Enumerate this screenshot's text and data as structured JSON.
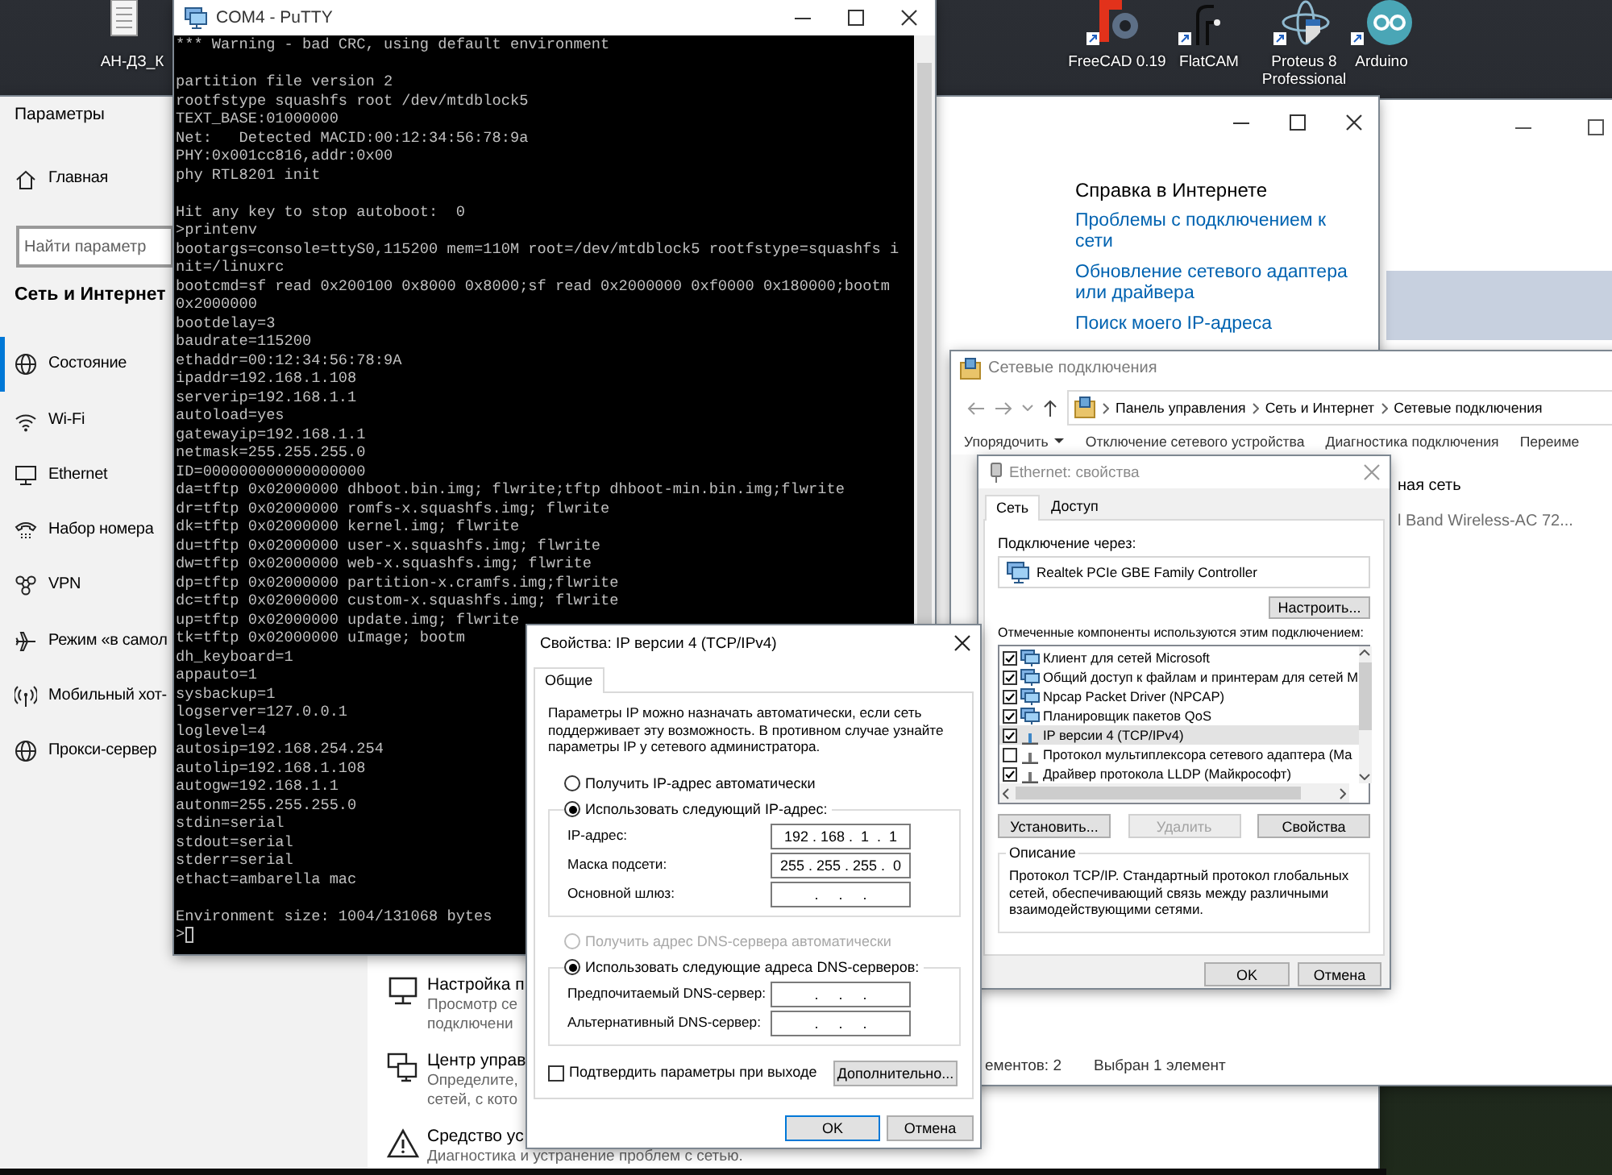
{
  "desktop": {
    "icons": [
      {
        "label": "АН-ДЗ_К"
      },
      {
        "label": "FreeCAD 0.19"
      },
      {
        "label": "FlatCAM"
      },
      {
        "label": "Proteus 8 Professional"
      },
      {
        "label": "Arduino"
      }
    ]
  },
  "settings": {
    "title": "Параметры",
    "home": "Главная",
    "search": {
      "placeholder": "Найти параметр"
    },
    "section": "Сеть и Интернет",
    "nav": [
      {
        "label": "Состояние",
        "selected": true
      },
      {
        "label": "Wi-Fi",
        "selected": false
      },
      {
        "label": "Ethernet",
        "selected": false
      },
      {
        "label": "Набор номера",
        "selected": false
      },
      {
        "label": "VPN",
        "selected": false
      },
      {
        "label": "Режим «в самол",
        "selected": false
      },
      {
        "label": "Мобильный хот-",
        "selected": false
      },
      {
        "label": "Прокси-сервер",
        "selected": false
      }
    ],
    "help": {
      "title": "Справка в Интернете",
      "links": [
        "Проблемы с подключением к сети",
        "Обновление сетевого адаптера или драйвера",
        "Поиск моего IP-адреса"
      ]
    },
    "related": [
      {
        "title": "Настройка п",
        "lines": [
          "Просмотр се",
          "подключени"
        ]
      },
      {
        "title": "Центр управ",
        "lines": [
          "Определите,",
          "сетей, с кото"
        ]
      },
      {
        "title": "Средство ус",
        "lines": [
          "Диагностика и устранение проблем с сетью."
        ]
      }
    ]
  },
  "putty": {
    "title": "COM4 - PuTTY",
    "blocks": [
      [
        "*** Warning - bad CRC, using default environment"
      ],
      [
        "partition file version 2",
        "rootfstype squashfs root /dev/mtdblock5",
        "TEXT_BASE:01000000",
        "Net:   Detected MACID:00:12:34:56:78:9a",
        "PHY:0x001cc816,addr:0x00",
        "phy RTL8201 init"
      ],
      [
        "Hit any key to stop autoboot:  0",
        ">printenv",
        "bootargs=console=ttyS0,115200 mem=110M root=/dev/mtdblock5 rootfstype=squashfs i",
        "nit=/linuxrc",
        "bootcmd=sf read 0x200100 0x8000 0x8000;sf read 0x2000000 0xf0000 0x180000;bootm",
        "0x2000000",
        "bootdelay=3",
        "baudrate=115200",
        "ethaddr=00:12:34:56:78:9A",
        "ipaddr=192.168.1.108",
        "serverip=192.168.1.1",
        "autoload=yes",
        "gatewayip=192.168.1.1",
        "netmask=255.255.255.0",
        "ID=000000000000000000",
        "da=tftp 0x02000000 dhboot.bin.img; flwrite;tftp dhboot-min.bin.img;flwrite",
        "dr=tftp 0x02000000 romfs-x.squashfs.img; flwrite",
        "dk=tftp 0x02000000 kernel.img; flwrite",
        "du=tftp 0x02000000 user-x.squashfs.img; flwrite",
        "dw=tftp 0x02000000 web-x.squashfs.img; flwrite",
        "dp=tftp 0x02000000 partition-x.cramfs.img;flwrite",
        "dc=tftp 0x02000000 custom-x.squashfs.img; flwrite",
        "up=tftp 0x02000000 update.img; flwrite",
        "tk=tftp 0x02000000 uImage; bootm",
        "dh_keyboard=1",
        "appauto=1",
        "sysbackup=1",
        "logserver=127.0.0.1",
        "loglevel=4",
        "autosip=192.168.254.254",
        "autolip=192.168.1.108",
        "autogw=192.168.1.1",
        "autonm=255.255.255.0",
        "stdin=serial",
        "stdout=serial",
        "stderr=serial",
        "ethact=ambarella mac"
      ],
      [
        "Environment size: 1004/131068 bytes"
      ]
    ],
    "prompt": ">"
  },
  "network_connections": {
    "title": "Сетевые подключения",
    "breadcrumb": [
      "Панель управления",
      "Сеть и Интернет",
      "Сетевые подключения"
    ],
    "toolbar": [
      "Упорядочить",
      "Отключение сетевого устройства",
      "Диагностика подключения",
      "Переиме"
    ],
    "items": [
      {
        "name": "ная сеть",
        "device": "l Band Wireless-AC 72..."
      }
    ],
    "status": [
      "ементов: 2",
      "Выбран 1 элемент"
    ]
  },
  "ethernet_properties": {
    "title": "Ethernet: свойства",
    "tabs": [
      {
        "label": "Сеть",
        "selected": true
      },
      {
        "label": "Доступ",
        "selected": false
      }
    ],
    "connect_via": "Подключение через:",
    "adapter": "Realtek PCIe GBE Family Controller",
    "configure": "Настроить...",
    "components_label": "Отмеченные компоненты используются этим подключением:",
    "components": [
      {
        "label": "Клиент для сетей Microsoft",
        "checked": true,
        "selected": false
      },
      {
        "label": "Общий доступ к файлам и принтерам для сетей M",
        "checked": true,
        "selected": false
      },
      {
        "label": "Npcap Packet Driver (NPCAP)",
        "checked": true,
        "selected": false
      },
      {
        "label": "Планировщик пакетов QoS",
        "checked": true,
        "selected": false
      },
      {
        "label": "IP версии 4 (TCP/IPv4)",
        "checked": true,
        "selected": true
      },
      {
        "label": "Протокол мультиплексора сетевого адаптера (Ма",
        "checked": false,
        "selected": false
      },
      {
        "label": "Драйвер протокола LLDP (Майкрософт)",
        "checked": true,
        "selected": false
      }
    ],
    "buttons": [
      {
        "label": "Установить...",
        "disabled": false
      },
      {
        "label": "Удалить",
        "disabled": true
      },
      {
        "label": "Свойства",
        "disabled": false
      }
    ],
    "description": {
      "title": "Описание",
      "text": "Протокол TCP/IP. Стандартный протокол глобальных сетей, обеспечивающий связь между различными взаимодействующими сетями."
    },
    "ok": "OK",
    "cancel": "Отмена"
  },
  "ipv4_properties": {
    "title": "Свойства: IP версии 4 (TCP/IPv4)",
    "tabs": [
      {
        "label": "Общие",
        "selected": true
      }
    ],
    "intro": "Параметры IP можно назначать автоматически, если сеть поддерживает эту возможность. В противном случае узнайте параметры IP у сетевого администратора.",
    "ip_mode": [
      {
        "label": "Получить IP-адрес автоматически",
        "selected": false,
        "disabled": false
      },
      {
        "label": "Использовать следующий IP-адрес:",
        "selected": true,
        "disabled": false
      }
    ],
    "ip_fields": [
      {
        "label": "IP-адрес:",
        "value": "192 . 168 .  1  .  1"
      },
      {
        "label": "Маска подсети:",
        "value": "255 . 255 . 255 .  0"
      },
      {
        "label": "Основной шлюз:",
        "value": ".     .     ."
      }
    ],
    "dns_mode": [
      {
        "label": "Получить адрес DNS-сервера автоматически",
        "selected": false,
        "disabled": true
      },
      {
        "label": "Использовать следующие адреса DNS-серверов:",
        "selected": true,
        "disabled": false
      }
    ],
    "dns_fields": [
      {
        "label": "Предпочитаемый DNS-сервер:",
        "value": ".     .     ."
      },
      {
        "label": "Альтернативный DNS-сервер:",
        "value": ".     .     ."
      }
    ],
    "confirm": {
      "label": "Подтвердить параметры при выходе",
      "checked": false
    },
    "advanced": "Дополнительно...",
    "ok": "OK",
    "cancel": "Отмена"
  }
}
